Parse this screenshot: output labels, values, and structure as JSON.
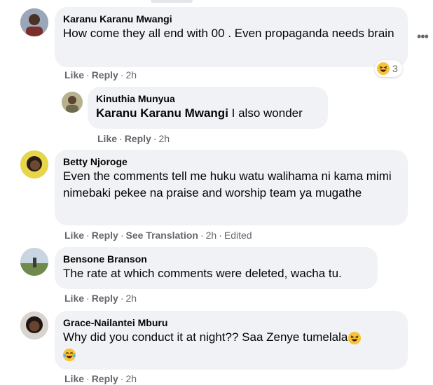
{
  "comments": [
    {
      "author": "Karanu Karanu Mwangi",
      "text": "How come they all end with 00 . Even propaganda needs brain",
      "actions": {
        "like": "Like",
        "reply": "Reply",
        "time": "2h"
      },
      "reaction_count": "3",
      "reaction_icon": "laughing-emoji-icon"
    },
    {
      "author": "Kinuthia Munyua",
      "mention": "Karanu Karanu Mwangi",
      "text": "I also wonder",
      "actions": {
        "like": "Like",
        "reply": "Reply",
        "time": "2h"
      }
    },
    {
      "author": "Betty Njoroge",
      "text": "Even the comments tell me huku watu walihama ni kama mimi nimebaki pekee na praise and worship team ya mugathe",
      "actions": {
        "like": "Like",
        "reply": "Reply",
        "translate": "See Translation",
        "time": "2h",
        "edited": "Edited"
      }
    },
    {
      "author": "Bensone Branson",
      "text": "The rate at which comments were deleted, wacha tu.",
      "actions": {
        "like": "Like",
        "reply": "Reply",
        "time": "2h"
      }
    },
    {
      "author": "Grace-Nailantei Mburu",
      "text": "Why did you conduct it at night?? Saa Zenye tumelala",
      "actions": {
        "like": "Like",
        "reply": "Reply",
        "time": "2h"
      }
    }
  ],
  "colors": {
    "bubble": "#f0f2f5",
    "meta": "#65676b",
    "text": "#050505",
    "emoji": "#f7c339"
  }
}
